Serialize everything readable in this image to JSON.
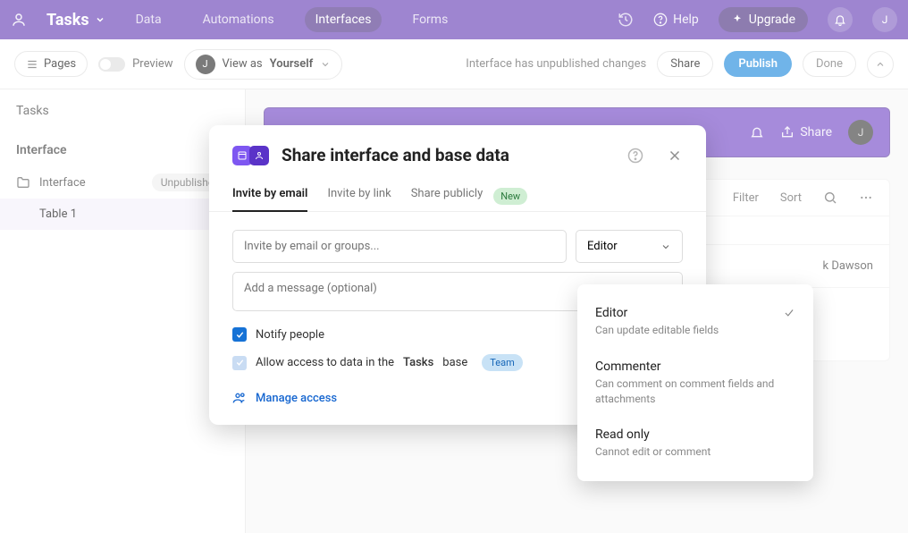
{
  "topnav": {
    "title": "Tasks",
    "items": [
      "Data",
      "Automations",
      "Interfaces",
      "Forms"
    ],
    "active_index": 2,
    "help": "Help",
    "upgrade": "Upgrade",
    "avatar_initial": "J"
  },
  "secondbar": {
    "pages": "Pages",
    "preview": "Preview",
    "viewas_label": "View as",
    "viewas_value": "Yourself",
    "viewas_initial": "J",
    "status": "Interface has unpublished changes",
    "share": "Share",
    "publish": "Publish",
    "done": "Done"
  },
  "leftpanel": {
    "topname": "Tasks",
    "section": "Interface",
    "row_label": "Interface",
    "row_badge": "Unpublished",
    "child": "Table 1"
  },
  "purplecard": {
    "share": "Share",
    "avatar_initial": "J"
  },
  "toolbar": {
    "filter": "Filter",
    "sort": "Sort"
  },
  "tablerow": {
    "name": "k Dawson"
  },
  "modal": {
    "title": "Share interface and base data",
    "tabs": [
      "Invite by email",
      "Invite by link",
      "Share publicly"
    ],
    "active_tab": 0,
    "new_badge": "New",
    "email_placeholder": "Invite by email or groups...",
    "role_selected": "Editor",
    "message_placeholder": "Add a message (optional)",
    "notify": "Notify people",
    "allow_prefix": "Allow access to data in the",
    "allow_base": "Tasks",
    "allow_suffix": "base",
    "team_badge": "Team",
    "manage": "Manage access"
  },
  "roledrop": {
    "options": [
      {
        "t": "Editor",
        "d": "Can update editable fields",
        "checked": true
      },
      {
        "t": "Commenter",
        "d": "Can comment on comment fields and attachments",
        "checked": false
      },
      {
        "t": "Read only",
        "d": "Cannot edit or comment",
        "checked": false
      }
    ]
  }
}
